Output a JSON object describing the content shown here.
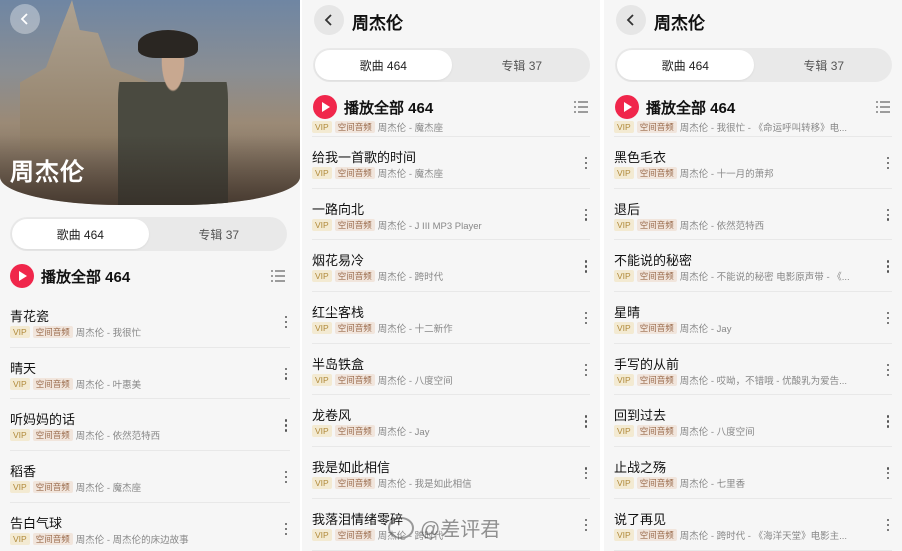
{
  "panel1": {
    "title": "周杰伦",
    "tabs": [
      "歌曲 464",
      "专辑 37"
    ],
    "play_all": "播放全部 464",
    "songs": [
      {
        "title": "青花瓷",
        "vip": "VIP",
        "spatial": "空间音频",
        "meta": "周杰伦 - 我很忙"
      },
      {
        "title": "晴天",
        "vip": "VIP",
        "spatial": "空间音频",
        "meta": "周杰伦 - 叶惠美"
      },
      {
        "title": "听妈妈的话",
        "vip": "VIP",
        "spatial": "空间音频",
        "meta": "周杰伦 - 依然范特西"
      },
      {
        "title": "稻香",
        "vip": "VIP",
        "spatial": "空间音频",
        "meta": "周杰伦 - 魔杰座"
      },
      {
        "title": "告白气球",
        "vip": "VIP",
        "spatial": "空间音频",
        "meta": "周杰伦 - 周杰伦的床边故事"
      }
    ]
  },
  "panel2": {
    "title": "周杰伦",
    "tabs": [
      "歌曲 464",
      "专辑 37"
    ],
    "play_all": "播放全部 464",
    "partial_meta": {
      "vip": "VIP",
      "spatial": "空间音频",
      "meta": "周杰伦 - 魔杰座"
    },
    "songs": [
      {
        "title": "给我一首歌的时间",
        "vip": "VIP",
        "spatial": "空间音频",
        "meta": "周杰伦 - 魔杰座"
      },
      {
        "title": "一路向北",
        "vip": "VIP",
        "spatial": "空间音频",
        "meta": "周杰伦 - J III MP3 Player"
      },
      {
        "title": "烟花易冷",
        "vip": "VIP",
        "spatial": "空间音频",
        "meta": "周杰伦 - 跨时代"
      },
      {
        "title": "红尘客栈",
        "vip": "VIP",
        "spatial": "空间音频",
        "meta": "周杰伦 - 十二新作"
      },
      {
        "title": "半岛铁盒",
        "vip": "VIP",
        "spatial": "空间音频",
        "meta": "周杰伦 - 八度空间"
      },
      {
        "title": "龙卷风",
        "vip": "VIP",
        "spatial": "空间音频",
        "meta": "周杰伦 - Jay"
      },
      {
        "title": "我是如此相信",
        "vip": "VIP",
        "spatial": "空间音频",
        "meta": "周杰伦 - 我是如此相信"
      },
      {
        "title": "我落泪情绪零碎",
        "vip": "VIP",
        "spatial": "空间音频",
        "meta": "周杰伦 - 跨时代"
      }
    ]
  },
  "panel3": {
    "title": "周杰伦",
    "tabs": [
      "歌曲 464",
      "专辑 37"
    ],
    "play_all": "播放全部 464",
    "partial_meta": {
      "vip": "VIP",
      "spatial": "空间音频",
      "meta": "周杰伦 - 我很忙 - 《命运呼叫转移》电..."
    },
    "songs": [
      {
        "title": "黑色毛衣",
        "vip": "VIP",
        "spatial": "空间音频",
        "meta": "周杰伦 - 十一月的萧邦"
      },
      {
        "title": "退后",
        "vip": "VIP",
        "spatial": "空间音频",
        "meta": "周杰伦 - 依然范特西"
      },
      {
        "title": "不能说的秘密",
        "vip": "VIP",
        "spatial": "空间音频",
        "meta": "周杰伦 - 不能说的秘密 电影原声带 - 《..."
      },
      {
        "title": "星晴",
        "vip": "VIP",
        "spatial": "空间音频",
        "meta": "周杰伦 - Jay"
      },
      {
        "title": "手写的从前",
        "vip": "VIP",
        "spatial": "空间音频",
        "meta": "周杰伦 - 哎呦，不错哦 - 优酸乳为爱告..."
      },
      {
        "title": "回到过去",
        "vip": "VIP",
        "spatial": "空间音频",
        "meta": "周杰伦 - 八度空间"
      },
      {
        "title": "止战之殇",
        "vip": "VIP",
        "spatial": "空间音频",
        "meta": "周杰伦 - 七里香"
      },
      {
        "title": "说了再见",
        "vip": "VIP",
        "spatial": "空间音频",
        "meta": "周杰伦 - 跨时代 - 《海洋天堂》电影主..."
      }
    ]
  },
  "watermark": "@差评君",
  "colors": {
    "accent": "#f0264b",
    "background": "#f6f6f6"
  }
}
